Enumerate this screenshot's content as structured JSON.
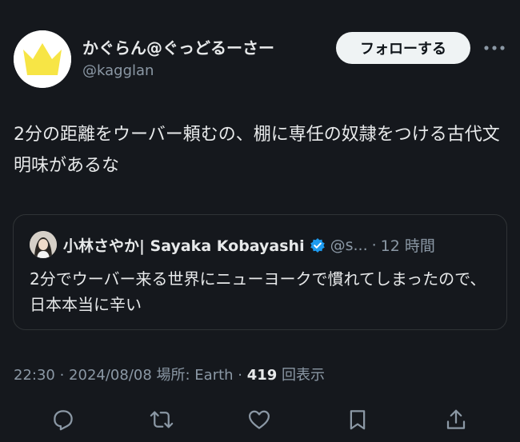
{
  "author": {
    "display_name": "かぐらん@ぐっどるーさー",
    "handle": "@kagglan",
    "avatar_icon": "crown-icon",
    "avatar_color": "#f7e545"
  },
  "header": {
    "follow_label": "フォローする",
    "more_icon": "more-horizontal-icon"
  },
  "tweet": {
    "text": "2分の距離をウーバー頼むの、棚に専任の奴隷をつける古代文明味があるな"
  },
  "quote": {
    "display_name": "小林さやか| Sayaka Kobayashi",
    "verified_icon": "verified-badge-icon",
    "verified_color": "#1d9bf0",
    "handle": "@s...",
    "separator": "·",
    "time": "12 時間",
    "text": "2分でウーバー来る世界にニューヨークで慣れてしまったので、日本本当に辛い"
  },
  "meta": {
    "time": "22:30",
    "sep1": " · ",
    "date": "2024/08/08",
    "location": " 場所: Earth",
    "sep2": " · ",
    "views_count": "419",
    "views_label": " 回表示"
  },
  "actions": [
    {
      "name": "reply-icon"
    },
    {
      "name": "retweet-icon"
    },
    {
      "name": "like-icon"
    },
    {
      "name": "bookmark-icon"
    },
    {
      "name": "share-icon"
    }
  ],
  "colors": {
    "background": "#15181d",
    "text_primary": "#e7e9ea",
    "text_secondary": "#8b98a5",
    "border": "#2f3336",
    "follow_button_bg": "#eff3f4"
  }
}
